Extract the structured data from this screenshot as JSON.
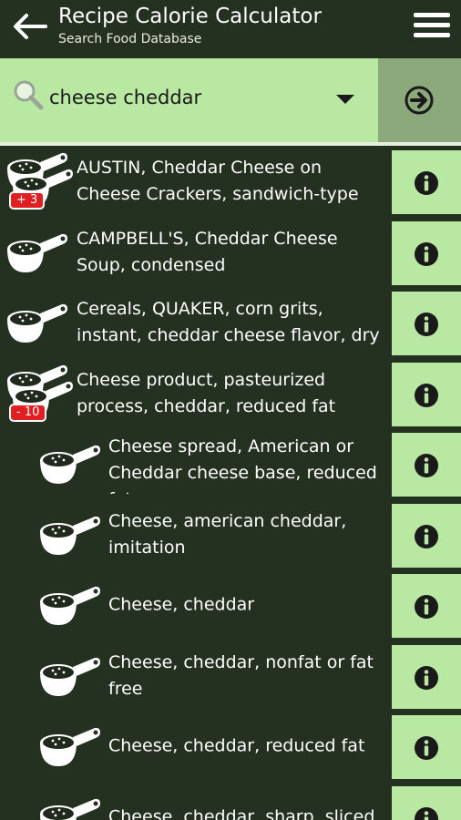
{
  "header": {
    "title": "Recipe Calorie Calculator",
    "subtitle": "Search Food Database"
  },
  "search": {
    "value": "cheese cheddar",
    "placeholder": ""
  },
  "results": [
    {
      "name": "AUSTIN, Cheddar Cheese on Cheese Crackers, sandwich-type",
      "icon": "measuring-cups-stack-icon",
      "badge": "+ 3",
      "indent": false
    },
    {
      "name": "CAMPBELL'S, Cheddar Cheese Soup, condensed",
      "icon": "measuring-cup-icon",
      "badge": "",
      "indent": false
    },
    {
      "name": "Cereals, QUAKER, corn grits, instant, cheddar cheese flavor, dry",
      "icon": "measuring-cup-icon",
      "badge": "",
      "indent": false
    },
    {
      "name": "Cheese product, pasteurized process, cheddar, reduced fat",
      "icon": "measuring-cups-stack-icon",
      "badge": "- 10",
      "indent": false
    },
    {
      "name": "Cheese spread, American or Cheddar cheese base, reduced fat",
      "icon": "measuring-cup-icon",
      "badge": "",
      "indent": true
    },
    {
      "name": "Cheese, american cheddar, imitation",
      "icon": "measuring-cup-icon",
      "badge": "",
      "indent": true
    },
    {
      "name": "Cheese, cheddar",
      "icon": "measuring-cup-icon",
      "badge": "",
      "indent": true
    },
    {
      "name": "Cheese, cheddar, nonfat or fat free",
      "icon": "measuring-cup-icon",
      "badge": "",
      "indent": true
    },
    {
      "name": "Cheese, cheddar, reduced fat",
      "icon": "measuring-cup-icon",
      "badge": "",
      "indent": true
    },
    {
      "name": "Cheese, cheddar, sharp, sliced",
      "icon": "measuring-cup-icon",
      "badge": "",
      "indent": true
    }
  ],
  "colors": {
    "background": "#243020",
    "accent": "#b9e8a3",
    "go_button": "#8ba97a",
    "badge": "#e02020"
  }
}
